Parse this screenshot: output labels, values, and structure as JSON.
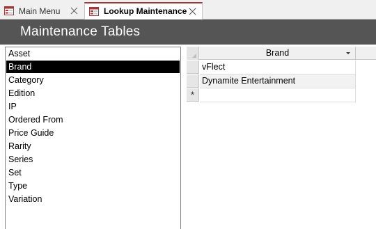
{
  "tabs": [
    {
      "label": "Main Menu",
      "active": false
    },
    {
      "label": "Lookup Maintenance",
      "active": true
    }
  ],
  "header": {
    "title": "Maintenance Tables"
  },
  "tables_list": {
    "items": [
      "Asset",
      "Brand",
      "Category",
      "Edition",
      "IP",
      "Ordered From",
      "Price Guide",
      "Rarity",
      "Series",
      "Set",
      "Type",
      "Variation"
    ],
    "selected": "Brand"
  },
  "datasheet": {
    "column_header": "Brand",
    "rows": [
      "vFlect",
      "Dynamite Entertainment"
    ],
    "new_record_marker": "*"
  },
  "colors": {
    "header_bg": "#555555",
    "active_tab_accent": "#a4373a",
    "selection_bg": "#000000"
  }
}
